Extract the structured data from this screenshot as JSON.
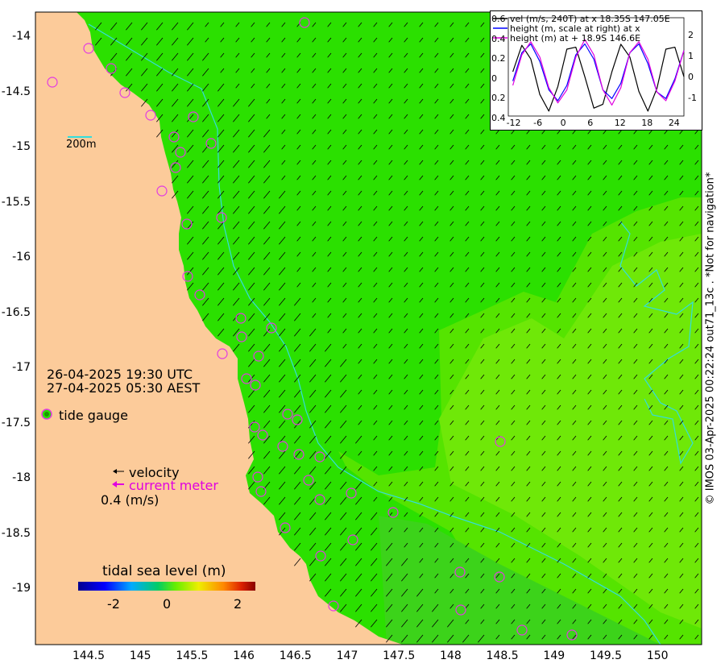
{
  "map": {
    "lat_ticks": [
      "-14",
      "-14.5",
      "-15",
      "-15.5",
      "-16",
      "-16.5",
      "-17",
      "-17.5",
      "-18",
      "-18.5",
      "-19"
    ],
    "lon_ticks": [
      "144.5",
      "145",
      "145.5",
      "146",
      "146.5",
      "147",
      "147.5",
      "148",
      "148.5",
      "149",
      "149.5",
      "150"
    ],
    "scale_label": "200m",
    "time_utc": "26-04-2025 19:30 UTC",
    "time_local": "27-04-2025 05:30 AEST",
    "tide_gauge_label": "tide gauge",
    "velocity_label": "velocity",
    "current_meter_label": "current meter",
    "velocity_scale": "0.4 (m/s)",
    "colorbar_title": "tidal sea level (m)",
    "colorbar_ticks": [
      "-2",
      "0",
      "2"
    ],
    "credit": "© IMOS 03-Apr-2025 00:22:24 out71_13c . *Not for navigation*",
    "colors": {
      "land": "#fccb9a",
      "sea_dark": "#2be000",
      "sea_mid": "#55e400",
      "sea_light": "#6fe808",
      "contour": "#33dddd",
      "gauge": "#e23be2"
    }
  },
  "inset": {
    "legend": [
      "vel (m/s, 240T) at x 18.35S 147.05E",
      "height (m, scale at right) at x",
      "height (m) at + 18.9S 146.6E"
    ],
    "y_left_ticks": [
      "0.6",
      "0.4",
      "0.2",
      "0",
      "0.2",
      "0.4"
    ],
    "y_right_ticks": [
      "2",
      "1",
      "0",
      "-1"
    ],
    "x_ticks": [
      "-12",
      "-6",
      "0",
      "6",
      "12",
      "18",
      "24"
    ]
  },
  "chart_data": {
    "type": "line",
    "x": [
      -12,
      -10,
      -8,
      -6,
      -4,
      -2,
      0,
      2,
      4,
      6,
      8,
      10,
      12,
      14,
      16,
      18,
      20,
      22,
      24,
      26
    ],
    "series": [
      {
        "name": "vel (m/s, 240T) at x 18.35S 147.05E",
        "color": "#000000",
        "values": [
          0.05,
          0.32,
          0.18,
          -0.18,
          -0.35,
          -0.1,
          0.28,
          0.3,
          0.0,
          -0.32,
          -0.28,
          0.05,
          0.33,
          0.2,
          -0.15,
          -0.35,
          -0.12,
          0.28,
          0.3,
          0.0
        ]
      },
      {
        "name": "height (m, scale at right) at x",
        "color": "#0000ff",
        "values": [
          -0.4,
          0.9,
          1.3,
          0.5,
          -0.8,
          -1.3,
          -0.6,
          0.8,
          1.3,
          0.6,
          -0.8,
          -1.2,
          -0.5,
          0.9,
          1.3,
          0.4,
          -0.9,
          -1.2,
          -0.3,
          1.0
        ]
      },
      {
        "name": "height (m) at + 18.9S 146.6E",
        "color": "#e000e0",
        "values": [
          -0.6,
          0.8,
          1.4,
          0.7,
          -0.7,
          -1.4,
          -0.8,
          0.7,
          1.5,
          0.8,
          -0.8,
          -1.5,
          -0.7,
          0.9,
          1.4,
          0.6,
          -0.9,
          -1.3,
          -0.4,
          1.0
        ]
      }
    ],
    "xlim": [
      -13,
      26
    ],
    "ylim_left": [
      -0.4,
      0.6
    ],
    "ylim_right": [
      -2,
      2.5
    ]
  }
}
